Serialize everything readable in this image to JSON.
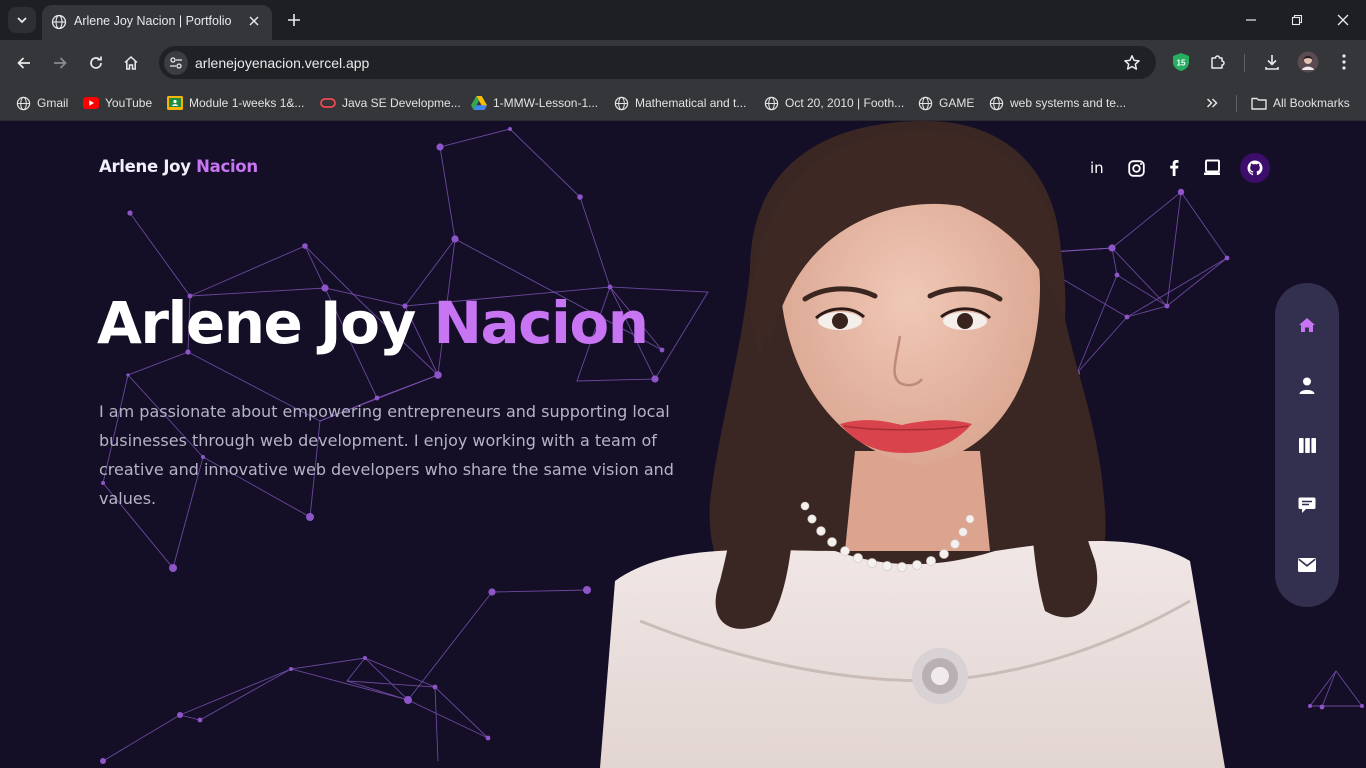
{
  "browser": {
    "tab_title": "Arlene Joy Nacion | Portfolio",
    "url": "arlenejoyenacion.vercel.app",
    "extension_badge": "15",
    "bookmarks": [
      {
        "label": "Gmail",
        "icon": "globe-icon"
      },
      {
        "label": "YouTube",
        "icon": "youtube-icon"
      },
      {
        "label": "Module 1-weeks 1&...",
        "icon": "classroom-icon"
      },
      {
        "label": "Java SE Developme...",
        "icon": "oracle-icon"
      },
      {
        "label": "1-MMW-Lesson-1...",
        "icon": "drive-icon"
      },
      {
        "label": "Mathematical and t...",
        "icon": "globe-icon"
      },
      {
        "label": "Oct 20, 2010 | Footh...",
        "icon": "globe-icon"
      },
      {
        "label": "GAME",
        "icon": "globe-icon"
      },
      {
        "label": "web systems and te...",
        "icon": "globe-icon"
      }
    ],
    "all_bookmarks": "All Bookmarks"
  },
  "site": {
    "logo_first": "Arlene Joy",
    "logo_accent": "Nacion",
    "hero_first": "Arlene Joy",
    "hero_accent": "Nacion",
    "description": "I am passionate about empowering entrepreneurs and supporting local businesses through web development. I enjoy working with a team of creative and innovative web developers who share the same vision and values.",
    "socials": [
      "linkedin-icon",
      "instagram-icon",
      "facebook-icon",
      "laptop-icon",
      "github-icon"
    ],
    "sidenav": [
      "home-icon",
      "user-icon",
      "columns-icon",
      "chat-icon",
      "mail-icon"
    ]
  },
  "colors": {
    "accent": "#c775f2",
    "page_background": "#140f27",
    "network_line": "#8a5bc4",
    "sidenav_background": "#332f4e"
  }
}
